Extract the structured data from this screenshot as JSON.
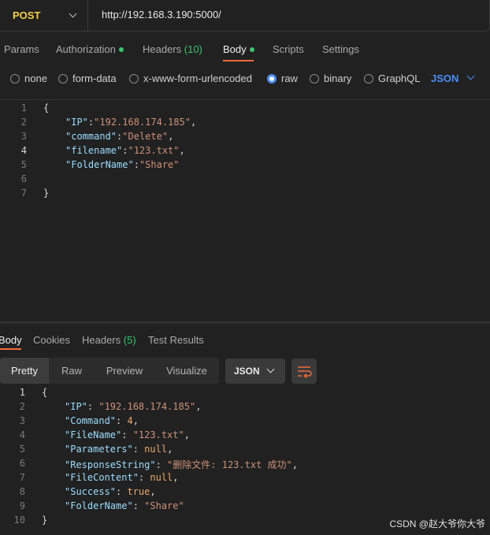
{
  "request": {
    "method": "POST",
    "url": "http://192.168.3.190:5000/"
  },
  "request_tabs": [
    {
      "label": "Params"
    },
    {
      "label": "Authorization",
      "dot": true
    },
    {
      "label": "Headers",
      "count": "(10)"
    },
    {
      "label": "Body",
      "dot": true,
      "active": true
    },
    {
      "label": "Scripts"
    },
    {
      "label": "Settings"
    }
  ],
  "body_types": [
    {
      "label": "none",
      "selected": false
    },
    {
      "label": "form-data",
      "selected": false
    },
    {
      "label": "x-www-form-urlencoded",
      "selected": false
    },
    {
      "label": "raw",
      "selected": true
    },
    {
      "label": "binary",
      "selected": false
    },
    {
      "label": "GraphQL",
      "selected": false
    }
  ],
  "body_format": "JSON",
  "request_body": {
    "line_numbers": [
      "1",
      "2",
      "3",
      "4",
      "5",
      "6",
      "7"
    ],
    "open_brace": "{",
    "close_brace": "}",
    "fields": [
      {
        "key": "\"IP\"",
        "sep": ":",
        "value": "\"192.168.174.185\"",
        "trail": ","
      },
      {
        "key": "\"command\"",
        "sep": ":",
        "value": "\"Delete\"",
        "trail": ","
      },
      {
        "key": "\"filename\"",
        "sep": ":",
        "value": "\"123.txt\"",
        "trail": ","
      },
      {
        "key": "\"FolderName\"",
        "sep": ":",
        "value": "\"Share\"",
        "trail": ""
      }
    ]
  },
  "response_tabs": [
    {
      "label": "Body",
      "active": true
    },
    {
      "label": "Cookies"
    },
    {
      "label": "Headers",
      "count": "(5)"
    },
    {
      "label": "Test Results"
    }
  ],
  "view_modes": [
    "Pretty",
    "Raw",
    "Preview",
    "Visualize"
  ],
  "response_format": "JSON",
  "response_body": {
    "line_numbers": [
      "1",
      "2",
      "3",
      "4",
      "5",
      "6",
      "7",
      "8",
      "9",
      "10"
    ],
    "open_brace": "{",
    "close_brace": "}",
    "fields": [
      {
        "key": "\"IP\"",
        "sep": ": ",
        "value": "\"192.168.174.185\"",
        "type": "s",
        "trail": ","
      },
      {
        "key": "\"Command\"",
        "sep": ": ",
        "value": "4",
        "type": "n",
        "trail": ","
      },
      {
        "key": "\"FileName\"",
        "sep": ": ",
        "value": "\"123.txt\"",
        "type": "s",
        "trail": ","
      },
      {
        "key": "\"Parameters\"",
        "sep": ": ",
        "value": "null",
        "type": "n",
        "trail": ","
      },
      {
        "key": "\"ResponseString\"",
        "sep": ": ",
        "value": "\"删除文件: 123.txt 成功\"",
        "type": "s",
        "trail": ","
      },
      {
        "key": "\"FileContent\"",
        "sep": ": ",
        "value": "null",
        "type": "n",
        "trail": ","
      },
      {
        "key": "\"Success\"",
        "sep": ": ",
        "value": "true",
        "type": "n",
        "trail": ","
      },
      {
        "key": "\"FolderName\"",
        "sep": ": ",
        "value": "\"Share\"",
        "type": "s",
        "trail": ""
      }
    ]
  },
  "watermark": "CSDN @赵大爷你大爷",
  "colors": {
    "method": "#f4d04a",
    "accent": "#f26b3a",
    "success": "#3ec26f",
    "link": "#4d8ef5",
    "json_key": "#9cdcfe",
    "json_string": "#ce9178"
  }
}
